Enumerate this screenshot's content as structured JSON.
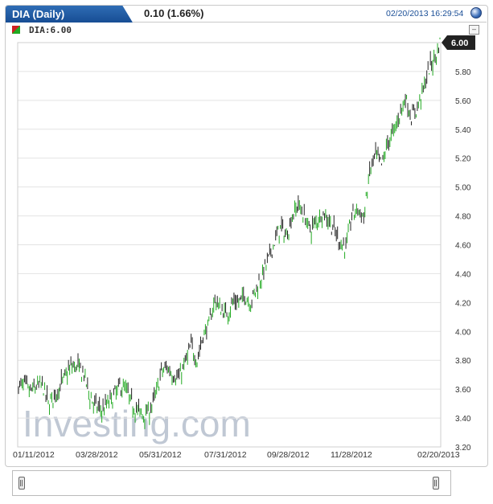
{
  "header": {
    "tab_title": "DIA (Daily)",
    "change": "0.10 (1.66%)",
    "datetime": "02/20/2013 16:29:54"
  },
  "legend": {
    "label": "DIA:6.00"
  },
  "watermark": "Investing.com",
  "colors": {
    "up": "#22aa22",
    "down": "#222222",
    "accent": "#1a4f96",
    "nav_fill": "#4a7fd4"
  },
  "chart_data": {
    "type": "candlestick",
    "title": "DIA (Daily)",
    "last_value": 6.0,
    "last_value_label": "6.00",
    "ylim": [
      3.2,
      6.0
    ],
    "y_ticks": [
      3.2,
      3.4,
      3.6,
      3.8,
      4.0,
      4.2,
      4.4,
      4.6,
      4.8,
      5.0,
      5.2,
      5.4,
      5.6,
      5.8
    ],
    "y_tick_labels": [
      "3.20",
      "3.40",
      "3.60",
      "3.80",
      "4.00",
      "4.20",
      "4.40",
      "4.60",
      "4.80",
      "5.00",
      "5.20",
      "5.40",
      "5.60",
      "5.80"
    ],
    "x_tick_labels": [
      "01/11/2012",
      "03/28/2012",
      "05/31/2012",
      "07/31/2012",
      "09/28/2012",
      "11/28/2012",
      "02/20/2013"
    ],
    "grid": "horizontal",
    "approx_close": [
      [
        0,
        3.62
      ],
      [
        5,
        3.63
      ],
      [
        10,
        3.58
      ],
      [
        15,
        3.62
      ],
      [
        20,
        3.63
      ],
      [
        25,
        3.5
      ],
      [
        30,
        3.55
      ],
      [
        35,
        3.62
      ],
      [
        40,
        3.7
      ],
      [
        45,
        3.76
      ],
      [
        50,
        3.75
      ],
      [
        55,
        3.7
      ],
      [
        60,
        3.55
      ],
      [
        65,
        3.48
      ],
      [
        70,
        3.45
      ],
      [
        75,
        3.5
      ],
      [
        80,
        3.55
      ],
      [
        85,
        3.62
      ],
      [
        90,
        3.6
      ],
      [
        95,
        3.5
      ],
      [
        100,
        3.45
      ],
      [
        105,
        3.42
      ],
      [
        110,
        3.45
      ],
      [
        115,
        3.55
      ],
      [
        120,
        3.72
      ],
      [
        125,
        3.75
      ],
      [
        130,
        3.7
      ],
      [
        135,
        3.68
      ],
      [
        140,
        3.78
      ],
      [
        145,
        3.9
      ],
      [
        150,
        3.8
      ],
      [
        155,
        3.97
      ],
      [
        160,
        4.05
      ],
      [
        165,
        4.22
      ],
      [
        170,
        4.15
      ],
      [
        175,
        4.12
      ],
      [
        180,
        4.2
      ],
      [
        185,
        4.2
      ],
      [
        190,
        4.25
      ],
      [
        195,
        4.2
      ],
      [
        200,
        4.3
      ],
      [
        205,
        4.4
      ],
      [
        210,
        4.5
      ],
      [
        215,
        4.62
      ],
      [
        220,
        4.72
      ],
      [
        225,
        4.66
      ],
      [
        230,
        4.8
      ],
      [
        235,
        4.88
      ],
      [
        240,
        4.8
      ],
      [
        245,
        4.7
      ],
      [
        250,
        4.76
      ],
      [
        255,
        4.82
      ],
      [
        260,
        4.78
      ],
      [
        265,
        4.7
      ],
      [
        270,
        4.62
      ],
      [
        275,
        4.58
      ],
      [
        280,
        4.8
      ],
      [
        285,
        4.85
      ],
      [
        290,
        4.78
      ],
      [
        295,
        5.1
      ],
      [
        300,
        5.22
      ],
      [
        305,
        5.15
      ],
      [
        310,
        5.3
      ],
      [
        315,
        5.38
      ],
      [
        320,
        5.5
      ],
      [
        325,
        5.62
      ],
      [
        330,
        5.48
      ],
      [
        335,
        5.55
      ],
      [
        340,
        5.68
      ],
      [
        345,
        5.82
      ],
      [
        350,
        5.9
      ],
      [
        354,
        6.0
      ]
    ]
  }
}
